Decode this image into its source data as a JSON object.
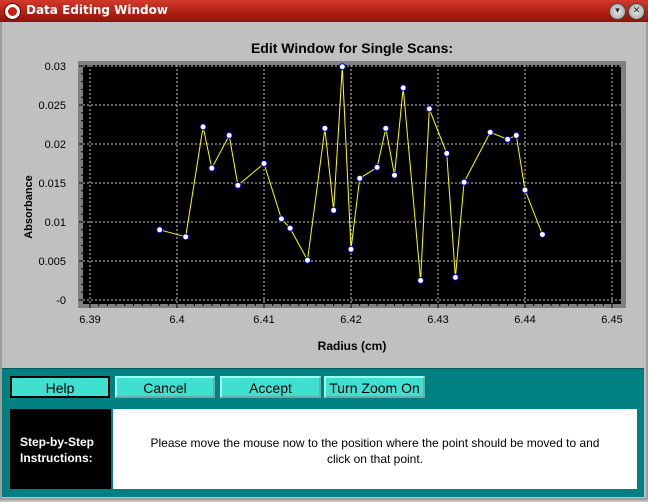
{
  "window": {
    "title": "Data Editing Window"
  },
  "buttons": {
    "help": "Help",
    "cancel": "Cancel",
    "accept": "Accept",
    "zoom": "Turn Zoom On"
  },
  "instructions": {
    "label": "Step-by-Step Instructions:",
    "text": "Please move the mouse now to the position where the point should be moved to and click on that point."
  },
  "colors": {
    "plot_bg": "#000000",
    "line": "#ffff00",
    "marker_fill": "#ffffff",
    "marker_edge": "#0000c0",
    "panel": "#008080",
    "button": "#40e0d0"
  },
  "chart_data": {
    "type": "scatter",
    "title": "Edit Window for Single Scans:",
    "xlabel": "Radius (cm)",
    "ylabel": "Absorbance",
    "xlim": [
      6.39,
      6.45
    ],
    "ylim": [
      0,
      0.03
    ],
    "x_ticks": [
      "6.39",
      "6.4",
      "6.41",
      "6.42",
      "6.43",
      "6.44",
      "6.45"
    ],
    "y_ticks": [
      "-0",
      "0.005",
      "0.01",
      "0.015",
      "0.02",
      "0.025",
      "0.03"
    ],
    "grid": true,
    "series": [
      {
        "x": [
          6.398,
          6.401,
          6.403,
          6.404,
          6.406,
          6.407,
          6.41,
          6.412,
          6.413,
          6.415,
          6.417,
          6.418,
          6.419,
          6.42,
          6.421,
          6.423,
          6.424,
          6.425,
          6.426,
          6.428,
          6.429,
          6.431,
          6.432,
          6.433,
          6.436,
          6.438,
          6.439,
          6.44,
          6.442
        ],
        "y": [
          0.009,
          0.0081,
          0.0222,
          0.0169,
          0.0211,
          0.0147,
          0.0175,
          0.0104,
          0.0092,
          0.0051,
          0.022,
          0.0115,
          0.0299,
          0.0065,
          0.0156,
          0.017,
          0.022,
          0.016,
          0.0272,
          0.0025,
          0.0245,
          0.0188,
          0.0029,
          0.0151,
          0.0215,
          0.0206,
          0.0211,
          0.0141,
          0.0084
        ]
      }
    ]
  }
}
